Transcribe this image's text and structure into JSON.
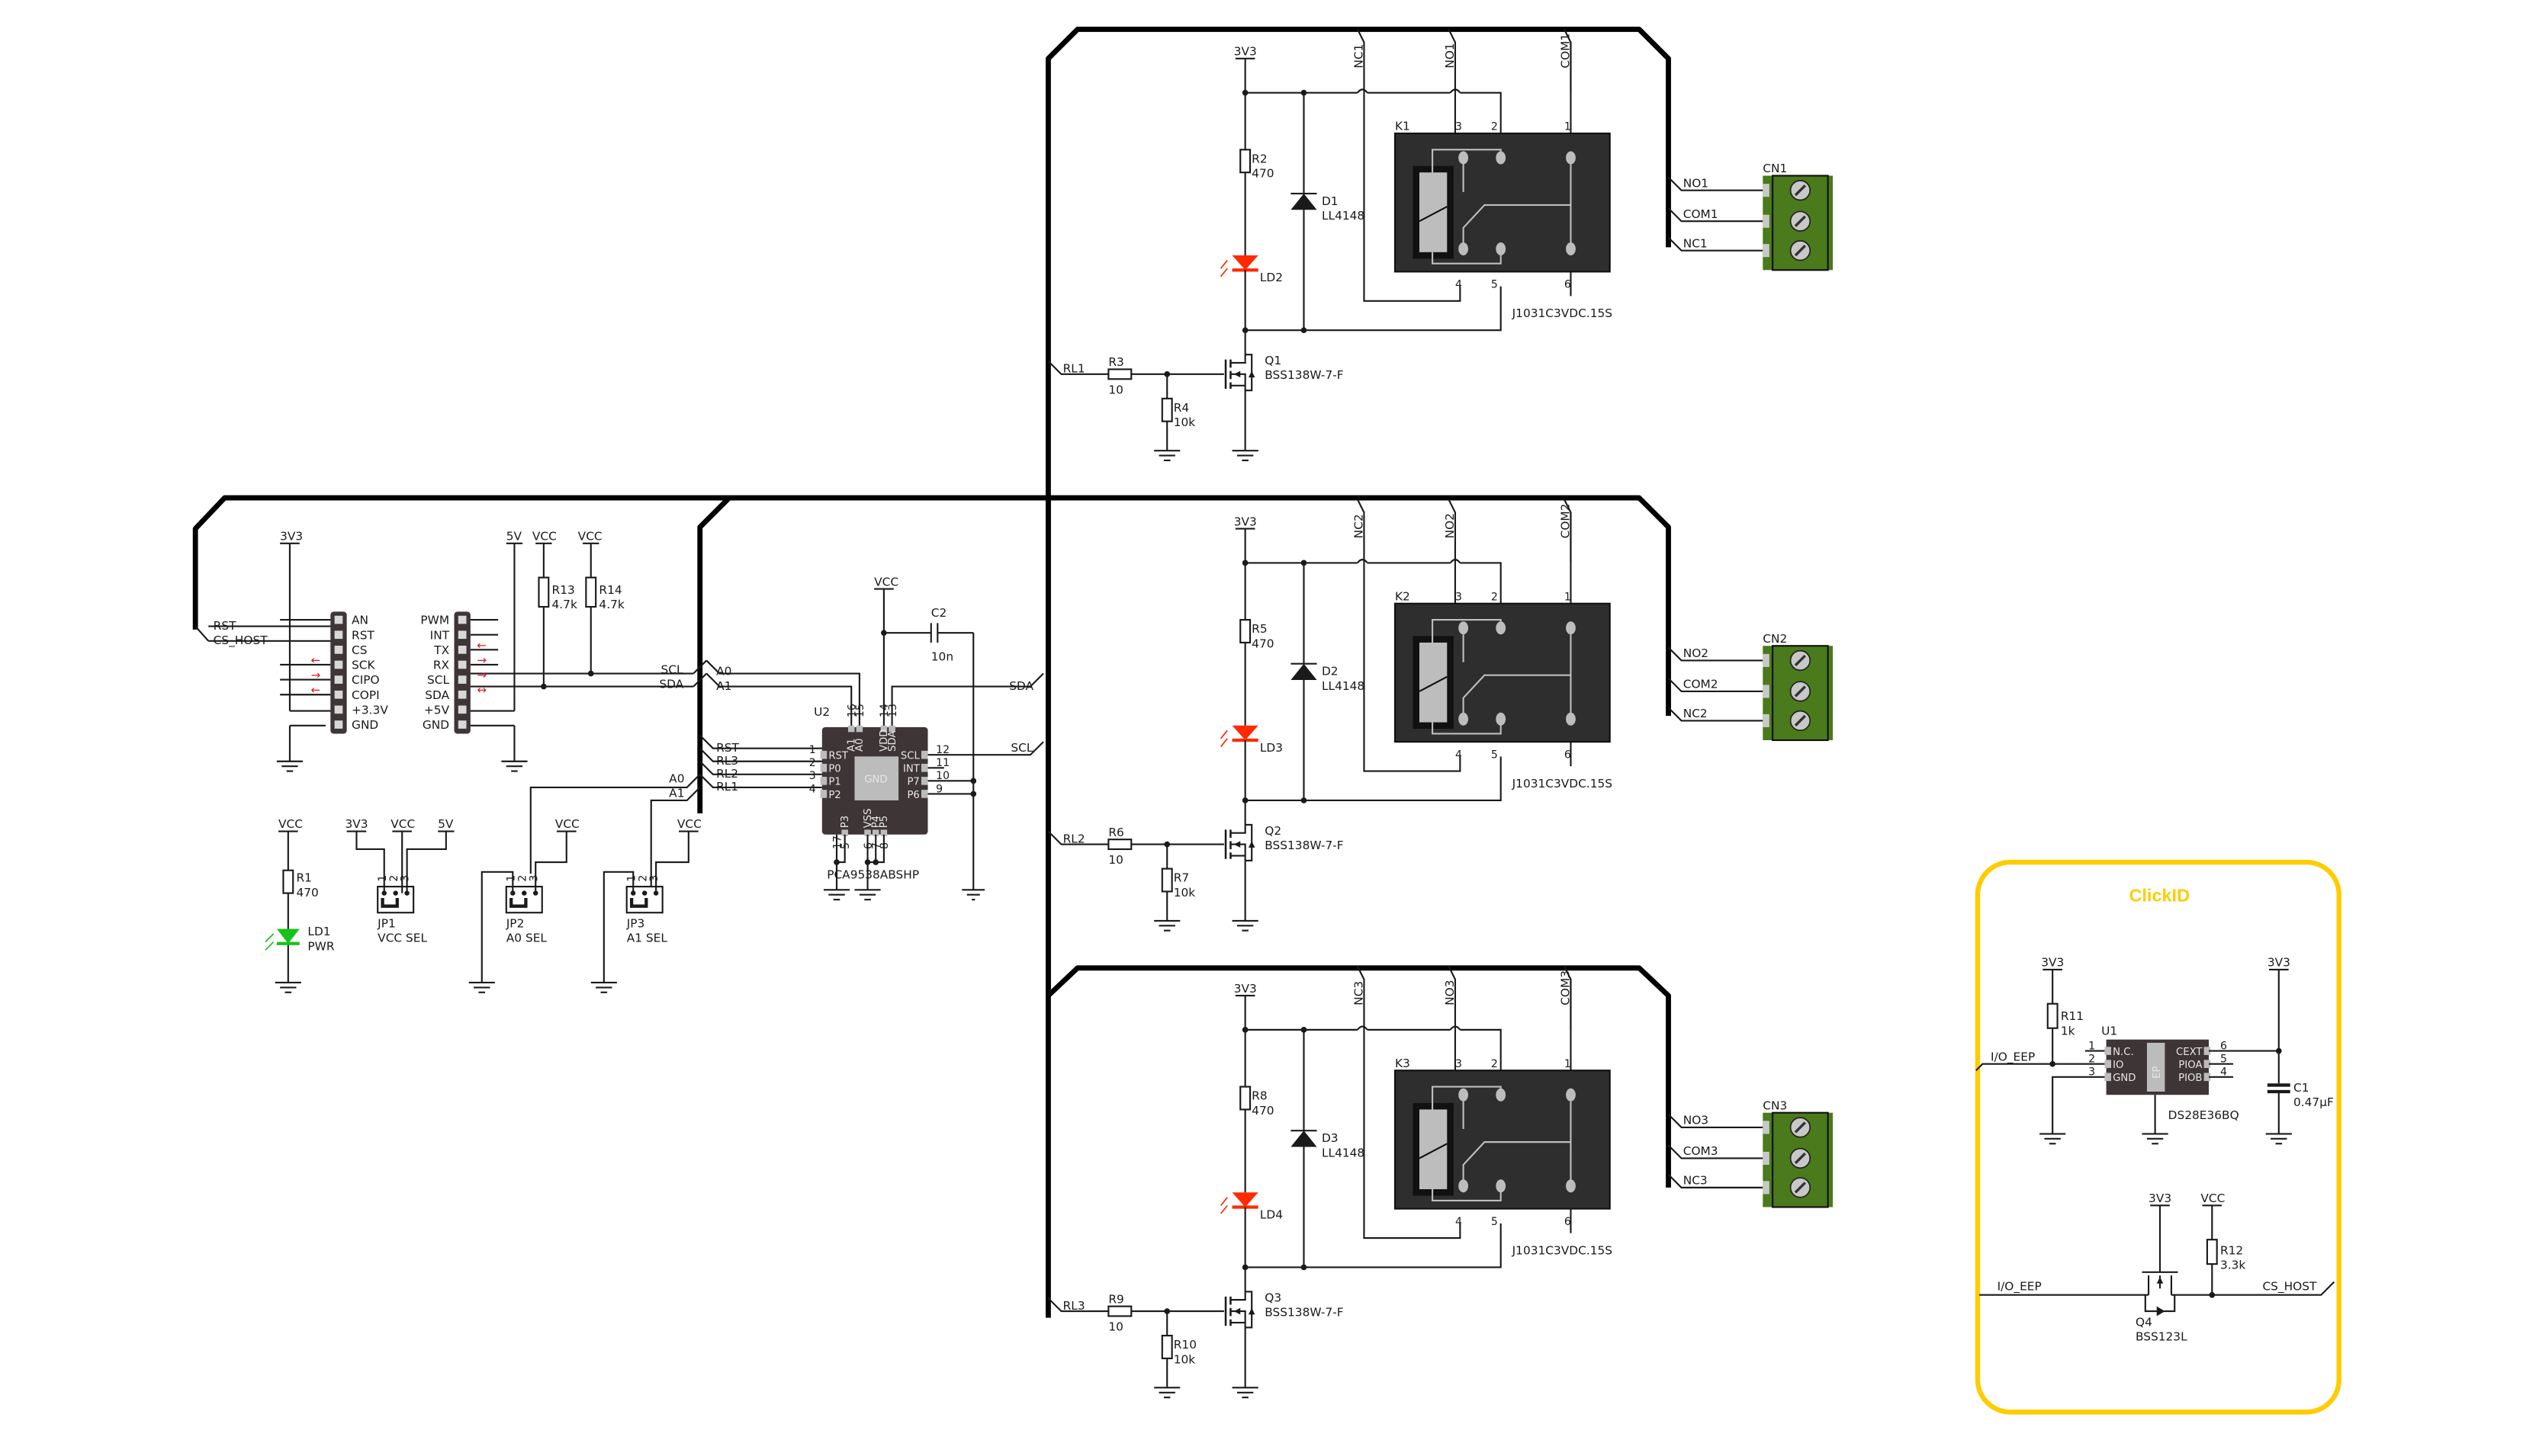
{
  "colors": {
    "wire": "#1a1a1a",
    "bus": "#000000",
    "relay_body": "#2e2e2e",
    "relay_contact": "#bdbdbd",
    "chip_body": "#3e3536",
    "terminal_green": "#4a7a1c",
    "led_red": "#ff2a00",
    "led_green": "#19c219",
    "clickid_border": "#ffcc00",
    "arrow_red": "#e8141c"
  },
  "mikrobus": {
    "left_header": {
      "power_label": "3V3",
      "pins": [
        "AN",
        "RST",
        "CS",
        "SCK",
        "CIPO",
        "COPI",
        "+3.3V",
        "GND"
      ],
      "nets": [
        "RST",
        "CS_HOST"
      ]
    },
    "right_header": {
      "power_labels": [
        "5V",
        "VCC",
        "VCC"
      ],
      "pins": [
        "PWM",
        "INT",
        "TX",
        "RX",
        "SCL",
        "SDA",
        "+5V",
        "GND"
      ]
    },
    "pullups": [
      {
        "ref": "R13",
        "value": "4.7k"
      },
      {
        "ref": "R14",
        "value": "4.7k"
      }
    ],
    "bus_nets": [
      "SCL",
      "SDA"
    ]
  },
  "expander": {
    "ref": "U2",
    "part": "PCA9538ABSHP",
    "center_label": "GND",
    "left_pins": [
      {
        "num": "1",
        "name": "RST",
        "net": "RST"
      },
      {
        "num": "2",
        "name": "P0",
        "net": "RL3"
      },
      {
        "num": "3",
        "name": "P1",
        "net": "RL2"
      },
      {
        "num": "4",
        "name": "P2",
        "net": "RL1"
      }
    ],
    "top_pins": [
      {
        "num": "16",
        "name": "A1"
      },
      {
        "num": "15",
        "name": "A0"
      },
      {
        "num": "14",
        "name": "VDD"
      },
      {
        "num": "13",
        "name": "SDA"
      }
    ],
    "right_pins": [
      {
        "num": "12",
        "name": "SCL",
        "net": "SCL"
      },
      {
        "num": "11",
        "name": "INT"
      },
      {
        "num": "10",
        "name": "P7"
      },
      {
        "num": "9",
        "name": "P6"
      }
    ],
    "bottom_pins": [
      {
        "num": "17",
        "name": ""
      },
      {
        "num": "5",
        "name": "P3"
      },
      {
        "num": "6",
        "name": "VSS"
      },
      {
        "num": "7",
        "name": "P4"
      },
      {
        "num": "8",
        "name": "P5"
      }
    ],
    "addr_nets": [
      "A0",
      "A1"
    ],
    "right_nets": [
      "SDA",
      "SCL"
    ],
    "vcc": "VCC",
    "cap": {
      "ref": "C2",
      "value": "10n"
    }
  },
  "power_led": {
    "vcc": "VCC",
    "resistor": {
      "ref": "R1",
      "value": "470"
    },
    "led": {
      "ref": "LD1",
      "label": "PWR"
    }
  },
  "jumpers": [
    {
      "ref": "JP1",
      "name": "VCC SEL",
      "pins": [
        "1",
        "2",
        "3"
      ],
      "nets": [
        "3V3",
        "VCC",
        "5V"
      ]
    },
    {
      "ref": "JP2",
      "name": "A0 SEL",
      "pins": [
        "1",
        "2",
        "3"
      ],
      "nets": [
        "VCC"
      ]
    },
    {
      "ref": "JP3",
      "name": "A1 SEL",
      "pins": [
        "1",
        "2",
        "3"
      ],
      "nets": [
        "VCC"
      ]
    }
  ],
  "relay_channels": [
    {
      "power": "3V3",
      "nc": "NC1",
      "no": "NO1",
      "com": "COM1",
      "resistor": {
        "ref": "R2",
        "value": "470"
      },
      "diode": {
        "ref": "D1",
        "value": "LL4148"
      },
      "led": {
        "ref": "LD2"
      },
      "relay": {
        "ref": "K1",
        "part": "J1031C3VDC.15S",
        "pins_top": [
          "3",
          "2",
          "1"
        ],
        "pins_bottom": [
          "4",
          "5",
          "6"
        ]
      },
      "gate_net": "RL1",
      "gate_res": {
        "ref": "R3",
        "value": "10"
      },
      "pulldown": {
        "ref": "R4",
        "value": "10k"
      },
      "fet": {
        "ref": "Q1",
        "part": "BSS138W-7-F"
      },
      "connector": {
        "ref": "CN1",
        "nets": [
          "NO1",
          "COM1",
          "NC1"
        ]
      }
    },
    {
      "power": "3V3",
      "nc": "NC2",
      "no": "NO2",
      "com": "COM2",
      "resistor": {
        "ref": "R5",
        "value": "470"
      },
      "diode": {
        "ref": "D2",
        "value": "LL4148"
      },
      "led": {
        "ref": "LD3"
      },
      "relay": {
        "ref": "K2",
        "part": "J1031C3VDC.15S",
        "pins_top": [
          "3",
          "2",
          "1"
        ],
        "pins_bottom": [
          "4",
          "5",
          "6"
        ]
      },
      "gate_net": "RL2",
      "gate_res": {
        "ref": "R6",
        "value": "10"
      },
      "pulldown": {
        "ref": "R7",
        "value": "10k"
      },
      "fet": {
        "ref": "Q2",
        "part": "BSS138W-7-F"
      },
      "connector": {
        "ref": "CN2",
        "nets": [
          "NO2",
          "COM2",
          "NC2"
        ]
      }
    },
    {
      "power": "3V3",
      "nc": "NC3",
      "no": "NO3",
      "com": "COM3",
      "resistor": {
        "ref": "R8",
        "value": "470"
      },
      "diode": {
        "ref": "D3",
        "value": "LL4148"
      },
      "led": {
        "ref": "LD4"
      },
      "relay": {
        "ref": "K3",
        "part": "J1031C3VDC.15S",
        "pins_top": [
          "3",
          "2",
          "1"
        ],
        "pins_bottom": [
          "4",
          "5",
          "6"
        ]
      },
      "gate_net": "RL3",
      "gate_res": {
        "ref": "R9",
        "value": "10"
      },
      "pulldown": {
        "ref": "R10",
        "value": "10k"
      },
      "fet": {
        "ref": "Q3",
        "part": "BSS138W-7-F"
      },
      "connector": {
        "ref": "CN3",
        "nets": [
          "NO3",
          "COM3",
          "NC3"
        ]
      }
    }
  ],
  "clickid": {
    "title": "ClickID",
    "power_labels": [
      "3V3",
      "3V3"
    ],
    "pullup": {
      "ref": "R11",
      "value": "1k"
    },
    "chip": {
      "ref": "U1",
      "part": "DS28E36BQ",
      "center": "EP",
      "left_pins": [
        {
          "num": "1",
          "name": "N.C."
        },
        {
          "num": "2",
          "name": "IO"
        },
        {
          "num": "3",
          "name": "GND"
        }
      ],
      "right_pins": [
        {
          "num": "6",
          "name": "CEXT"
        },
        {
          "num": "5",
          "name": "PIOA"
        },
        {
          "num": "4",
          "name": "PIOB"
        }
      ]
    },
    "cap": {
      "ref": "C1",
      "value": "0.47µF"
    },
    "net_io": "I/O_EEP",
    "fet": {
      "ref": "Q4",
      "part": "BSS123L",
      "gate_power": "3V3"
    },
    "pullup2": {
      "ref": "R12",
      "value": "3.3k",
      "power": "VCC"
    },
    "net_io2": "I/O_EEP",
    "net_cs": "CS_HOST"
  }
}
